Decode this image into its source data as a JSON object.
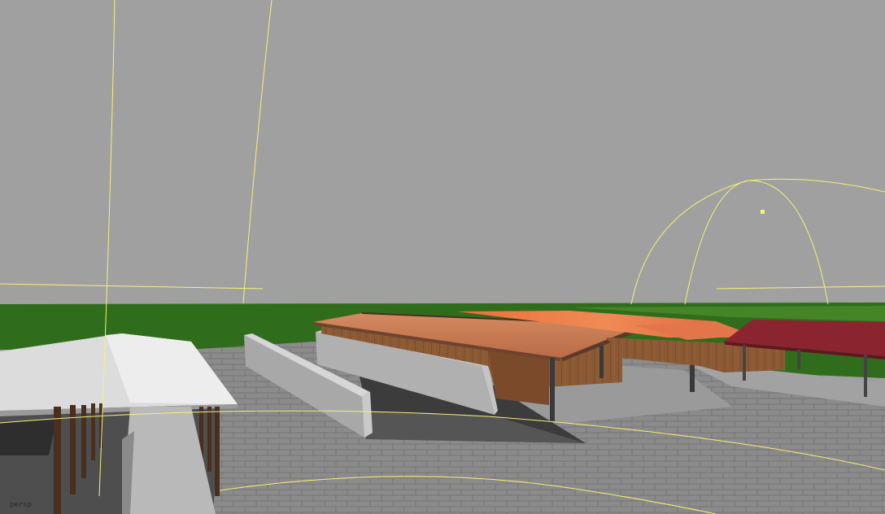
{
  "viewport": {
    "camera_label": "persp"
  },
  "colors": {
    "sky": "#a0a0a0",
    "grass": "#2f6d1c",
    "pavement": "#8a8a8a",
    "roof_orange": "#c07a55",
    "roof_red": "#8a2530",
    "roof_white": "#e2e2e2",
    "wood": "#8a5530",
    "concrete": "#a9a9a9",
    "gizmo_yellow": "#f2f27a"
  }
}
